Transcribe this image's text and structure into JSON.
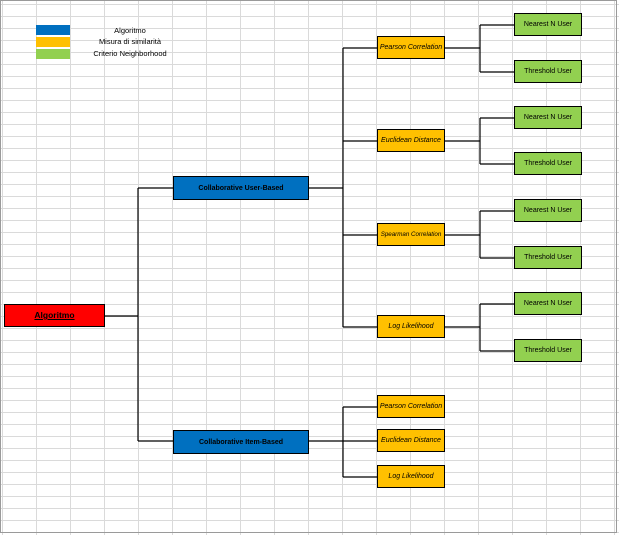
{
  "legend": [
    {
      "label": "Algoritmo",
      "color": "#0070c0"
    },
    {
      "label": "Misura di similarità",
      "color": "#ffc000"
    },
    {
      "label": "Criterio Neighborhood",
      "color": "#92d050"
    }
  ],
  "root": {
    "label": "Algoritmo",
    "color": "#ff0000"
  },
  "algorithms": [
    {
      "label": "Collaborative User-Based"
    },
    {
      "label": "Collaborative Item-Based"
    }
  ],
  "user_based_measures": [
    {
      "label": "Pearson Correlation",
      "criteria": [
        "Nearest N User",
        "Threshold User"
      ]
    },
    {
      "label": "Euclidean Distance",
      "criteria": [
        "Nearest N User",
        "Threshold User"
      ]
    },
    {
      "label": "Spearman Correlation",
      "criteria": [
        "Nearest N User",
        "Threshold User"
      ]
    },
    {
      "label": "Log Likelihood",
      "criteria": [
        "Nearest N User",
        "Threshold User"
      ]
    }
  ],
  "item_based_measures": [
    {
      "label": "Pearson Correlation"
    },
    {
      "label": "Euclidean Distance"
    },
    {
      "label": "Log Likelihood"
    }
  ]
}
